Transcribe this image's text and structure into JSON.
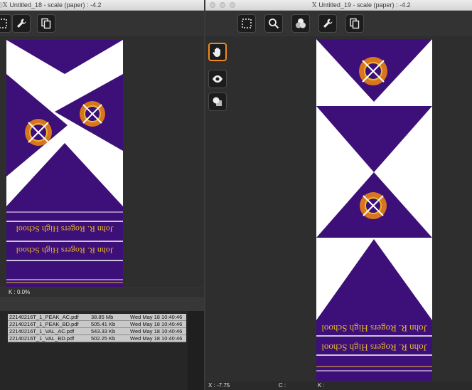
{
  "left_window": {
    "title": "Untitled_18 - scale (paper) : -4.2",
    "status_k": "K : 0.0%",
    "files": [
      {
        "name": "22140216T_1_PEAK_AC.pdf",
        "size": "38.85 Mb",
        "date": "Wed May 18 10:40:46"
      },
      {
        "name": "22140216T_1_PEAK_BD.pdf",
        "size": "505.41 Kb",
        "date": "Wed May 18 10:40:46"
      },
      {
        "name": "22140216T_1_VAL_AC.pdf",
        "size": "543.33 Kb",
        "date": "Wed May 18 10:40:46"
      },
      {
        "name": "22140216T_1_VAL_BD.pdf",
        "size": "502.25 Kb",
        "date": "Wed May 18 10:40:46"
      }
    ]
  },
  "right_window": {
    "title": "Untitled_19 - scale (paper) : -4.2",
    "status_x": "X : -7.75",
    "status_c": "C :",
    "status_k": "K :"
  },
  "artwork": {
    "school_line": "John R. Rogers High School",
    "purple": "#3d0f78",
    "gold": "#e8b830",
    "crest_orange": "#d9751e"
  },
  "icons": {
    "crop": "marquee-icon",
    "zoom": "magnifier-icon",
    "channels": "color-circles-icon",
    "settings": "wrench-icon",
    "copy": "copy-pages-icon",
    "hand": "hand-icon",
    "preview": "eye-icon",
    "separations": "overlap-shapes-icon"
  }
}
